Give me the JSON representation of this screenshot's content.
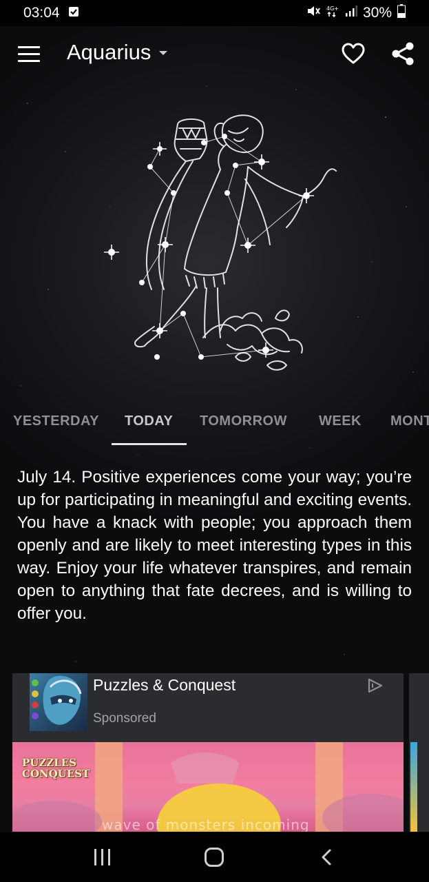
{
  "status_bar": {
    "time": "03:04",
    "battery": "30%",
    "icons": [
      "checkbox-notification-icon",
      "mute-icon",
      "4g-icon",
      "signal-icon",
      "battery-icon"
    ]
  },
  "app_bar": {
    "title": "Aquarius",
    "menu_icon": "hamburger-menu-icon",
    "favorite_icon": "heart-icon",
    "share_icon": "share-icon"
  },
  "tabs": [
    {
      "label": "YESTERDAY",
      "active": false
    },
    {
      "label": "TODAY",
      "active": true
    },
    {
      "label": "TOMORROW",
      "active": false
    },
    {
      "label": "WEEK",
      "active": false
    },
    {
      "label": "MONT",
      "active": false
    }
  ],
  "horoscope": {
    "text": "July 14. Positive experiences come your way; you’re up for participating in meaningful and exciting events. You have a knack with people; you approach them openly and are likely to meet interesting types in this way. Enjoy your life whatever transpires, and remain open to anything that fate decrees, and is willing to offer you."
  },
  "ad": {
    "title": "Puzzles & Conquest",
    "sponsored": "Sponsored",
    "logo_text_line1": "PUZZLES",
    "logo_text_line2": "CONQUEST",
    "caption": "wave of monsters incoming",
    "play_icon": "ad-choices-play-icon"
  },
  "nav_bar": {
    "icons": [
      "recents-icon",
      "home-icon",
      "back-icon"
    ]
  },
  "colors": {
    "background": "#17181b",
    "text": "#ffffff",
    "tab_inactive": "#8f9094",
    "tab_active": "#c9c9cb",
    "ad_card": "#2b2c2f"
  }
}
